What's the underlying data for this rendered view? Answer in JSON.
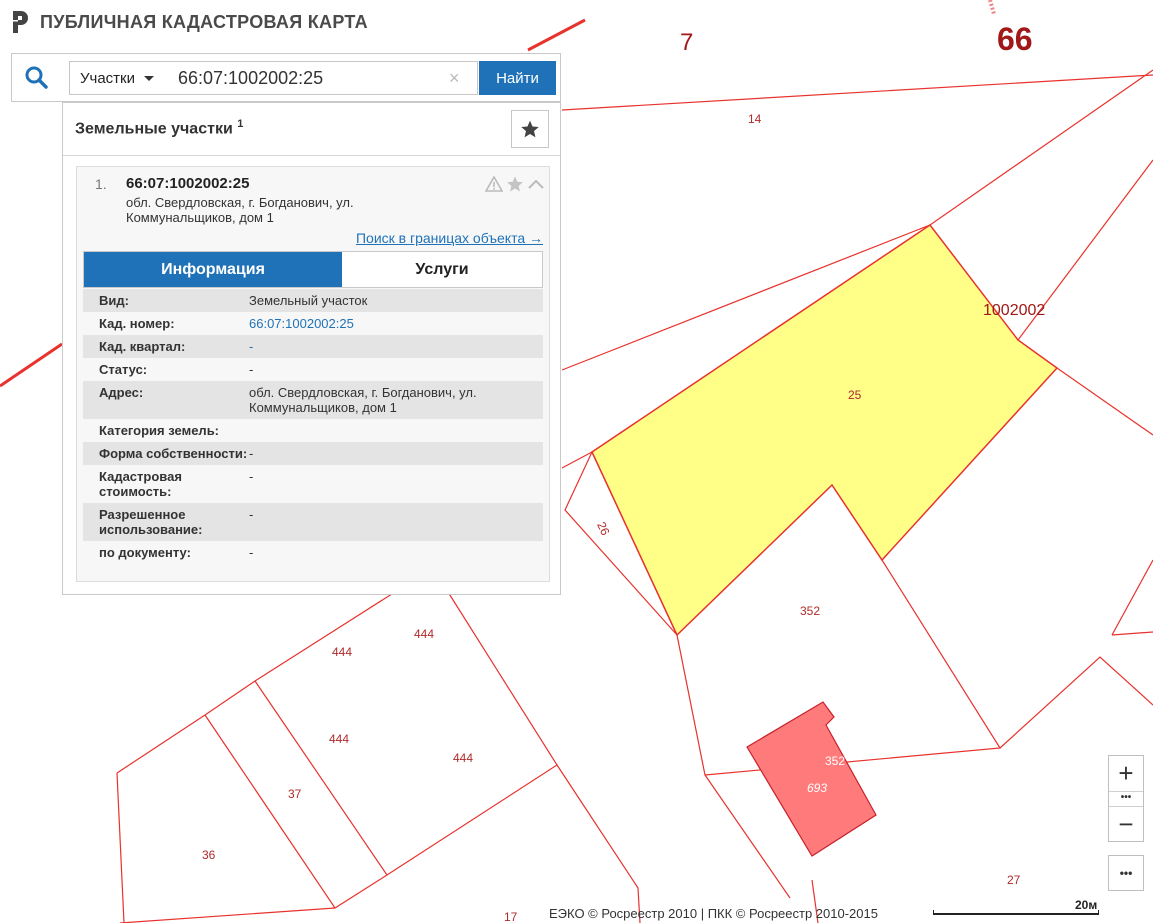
{
  "app": {
    "title": "ПУБЛИЧНАЯ КАДАСТРОВАЯ КАРТА",
    "logo_icon": "cadastral-logo-icon"
  },
  "search": {
    "type_label": "Участки",
    "value": "66:07:1002002:25",
    "clear_icon": "×",
    "button_label": "Найти"
  },
  "panel": {
    "title": "Земельные участки",
    "count": "1"
  },
  "result": {
    "index": "1.",
    "number": "66:07:1002002:25",
    "address": "обл. Свердловская, г. Богданович, ул. Коммунальщиков, дом 1",
    "search_link": "Поиск в границах объекта →"
  },
  "tabs": [
    {
      "label": "Информация",
      "active": true
    },
    {
      "label": "Услуги",
      "active": false
    }
  ],
  "info": [
    {
      "label": "Вид:",
      "value": "Земельный участок"
    },
    {
      "label": "Кад. номер:",
      "value": "66:07:1002002:25"
    },
    {
      "label": "Кад. квартал:",
      "value": "-"
    },
    {
      "label": "Статус:",
      "value": "-"
    },
    {
      "label": "Адрес:",
      "value": "обл. Свердловская, г. Богданович, ул. Коммунальщиков, дом 1"
    },
    {
      "label": "Категория земель:",
      "value": ""
    },
    {
      "label": "Форма собственности:",
      "value": "-"
    },
    {
      "label": "Кадастровая стоимость:",
      "value": "-"
    },
    {
      "label": "Разрешенное использование:",
      "value": "-"
    },
    {
      "label": "по документу:",
      "value": "-"
    }
  ],
  "map": {
    "colors": {
      "boundary": "#e8322d",
      "selected_fill": "#ffff88",
      "building_fill": "#ff7b7b",
      "label": "#b02a2a"
    },
    "labels": {
      "region": "66",
      "district": "7",
      "quarter": "1002002",
      "p14": "14",
      "p25": "25",
      "p26": "26",
      "p352a": "352",
      "p352b": "352",
      "p693": "693",
      "p444a": "444",
      "p444b": "444",
      "p444c": "444",
      "p444d": "444",
      "p37": "37",
      "p36": "36",
      "p27": "27",
      "p17": "17"
    }
  },
  "controls": {
    "zoom_in": "+",
    "zoom_out": "−",
    "zoom_mid": "•••",
    "more": "•••"
  },
  "attribution": "ЕЭКО © Росреестр 2010 | ПКК © Росреестр 2010-2015",
  "scale_label": "20м"
}
